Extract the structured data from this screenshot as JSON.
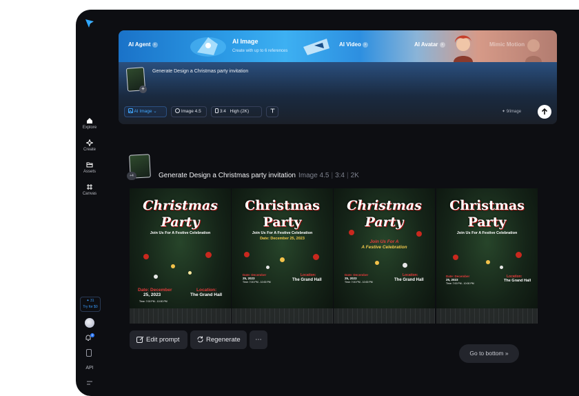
{
  "sidebar": {
    "items": [
      {
        "label": "Explore",
        "icon": "home-icon"
      },
      {
        "label": "Create",
        "icon": "sparkle-icon"
      },
      {
        "label": "Assets",
        "icon": "folder-icon"
      },
      {
        "label": "Canvas",
        "icon": "canvas-icon"
      }
    ],
    "credits": "✦ 31",
    "try_label": "Try for $0",
    "notification_count": "2",
    "api_label": "API"
  },
  "banner": {
    "items": [
      "AI Agent",
      "AI Image",
      "AI Video",
      "AI Avatar",
      "Mimic Motion"
    ],
    "active_subtitle": "Create with up to 6 references"
  },
  "composer": {
    "prompt": "Generate Design a Christmas party invitation",
    "add_symbol": "+",
    "tools": {
      "mode": "AI Image",
      "model": "Image 4.5",
      "ratio": "3:4",
      "quality": "High (2K)"
    },
    "cost": "✦ 9/image"
  },
  "result": {
    "badge": "+4",
    "title": "Generate Design a Christmas party invitation",
    "model": "Image 4.5",
    "ratio": "3:4",
    "resolution": "2K",
    "cards": [
      {
        "line1": "Christmas",
        "line2": "Party",
        "sub": "Join Us For A Festive Celebration",
        "sub2": "",
        "date_label": "Date: December",
        "date": "25, 2023",
        "time": "Time: 7:00 PM - 10:00 PM",
        "loc_label": "Location:",
        "loc": "The Grand Hall"
      },
      {
        "line1": "Christmas",
        "line2": "Party",
        "sub": "Join Us For A Festive Celebration",
        "sub2": "Date: December 25, 2023",
        "date_label": "Date: December",
        "date": "25, 2023",
        "time": "Time: 7:00 PM - 10:00 PM",
        "loc_label": "Location:",
        "loc": "The Grand Hall"
      },
      {
        "line1": "Christmas",
        "line2": "Party",
        "sub": "Join Us For A",
        "sub2": "A Festive Celebration",
        "date_label": "Date: December",
        "date": "25, 2023",
        "time": "Time: 7:00 PM - 10:00 PM",
        "loc_label": "Location:",
        "loc": "The Grand Hall"
      },
      {
        "line1": "Christmas",
        "line2": "Party",
        "sub": "Join Us For A Festive Celebration",
        "sub2": "",
        "date_label": "Date: December",
        "date": "25, 2023",
        "time": "Time: 7:00 PM - 10:00 PM",
        "loc_label": "Location:",
        "loc": "The Grand Hall"
      }
    ],
    "actions": {
      "edit": "Edit prompt",
      "regenerate": "Regenerate",
      "more": "⋯"
    }
  },
  "go_bottom": "Go to bottom »"
}
